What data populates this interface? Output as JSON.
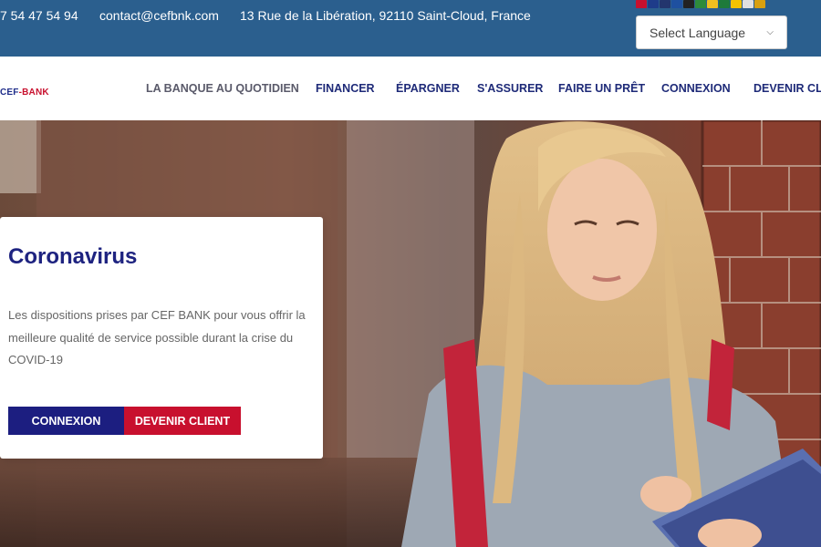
{
  "topbar": {
    "phone": "7 54 47 54 94",
    "email": "contact@cefbnk.com",
    "address": "13 Rue de la Libération, 92110 Saint-Cloud, France",
    "language_select": {
      "value": "Select Language",
      "icon": "chevron-down-icon"
    },
    "flags": [
      {
        "name": "flag-da",
        "color": "#c8102e"
      },
      {
        "name": "flag-nl",
        "color": "#1e3c8a"
      },
      {
        "name": "flag-en",
        "color": "#23356d"
      },
      {
        "name": "flag-fr",
        "color": "#1e50a0"
      },
      {
        "name": "flag-de",
        "color": "#222222"
      },
      {
        "name": "flag-it",
        "color": "#2e8b3a"
      },
      {
        "name": "flag-lt",
        "color": "#f0c020"
      },
      {
        "name": "flag-pt",
        "color": "#1e7a3a"
      },
      {
        "name": "flag-ro",
        "color": "#f3c200"
      },
      {
        "name": "flag-ru",
        "color": "#e0e0e0"
      },
      {
        "name": "flag-es",
        "color": "#d8a010"
      }
    ]
  },
  "logo": {
    "prefix": "CEF",
    "suffix": "-BANK"
  },
  "nav": {
    "items": [
      "LA BANQUE AU QUOTIDIEN",
      "FINANCER",
      "ÉPARGNER",
      "S'ASSURER",
      "FAIRE UN PRÊT",
      "CONNEXION",
      "DEVENIR CLI"
    ]
  },
  "hero": {
    "title": "Coronavirus",
    "text": "Les dispositions prises par CEF BANK pour vous offrir la meilleure qualité de service possible durant la crise du COVID-19",
    "login_button": "CONNEXION",
    "client_button": "DEVENIR CLIENT"
  },
  "colors": {
    "topbar": "#2b5f8e",
    "nav_text": "#1e2a78",
    "primary_button": "#1c1e80",
    "accent_button": "#c8102e"
  }
}
